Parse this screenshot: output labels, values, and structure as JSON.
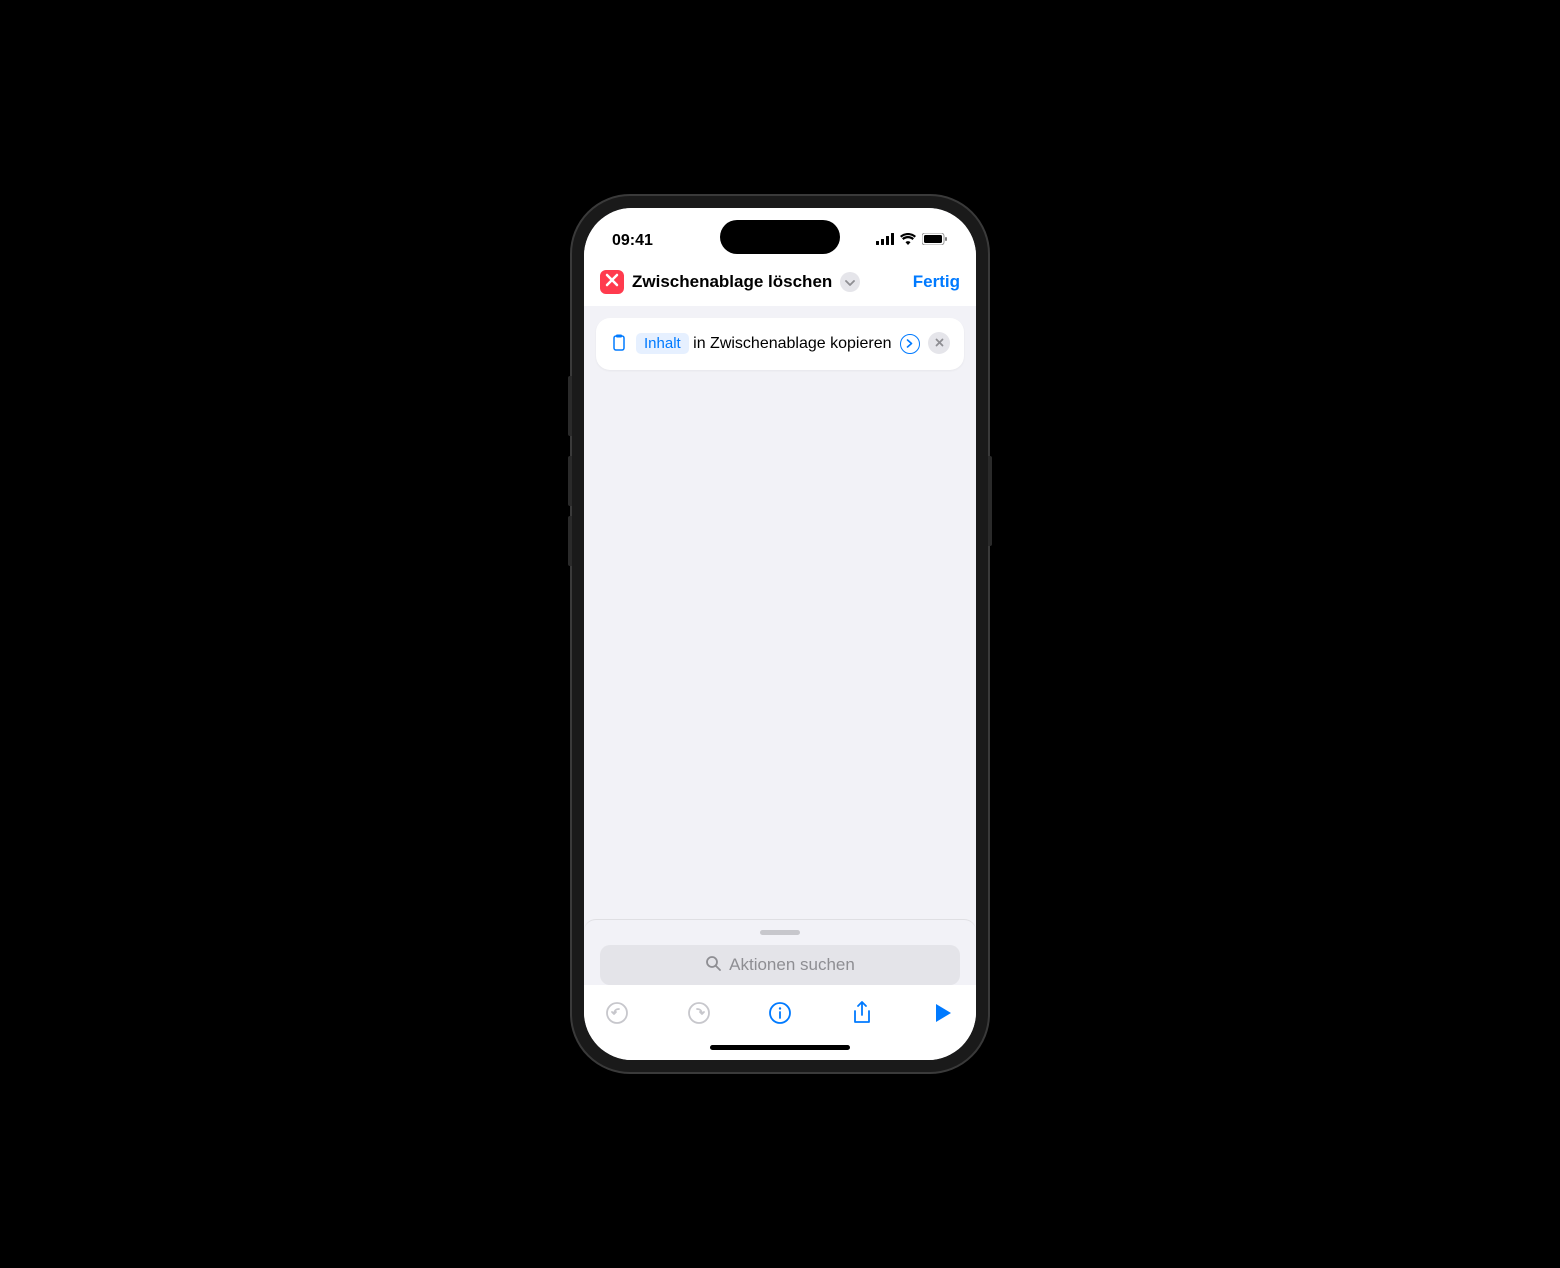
{
  "statusBar": {
    "time": "09:41"
  },
  "header": {
    "title": "Zwischenablage löschen",
    "doneLabel": "Fertig"
  },
  "action": {
    "tokenLabel": "Inhalt",
    "textPart1": " in Zwischenablage kopieren "
  },
  "search": {
    "placeholder": "Aktionen suchen"
  },
  "colors": {
    "accent": "#007aff",
    "badge": "#ff3b4e"
  }
}
